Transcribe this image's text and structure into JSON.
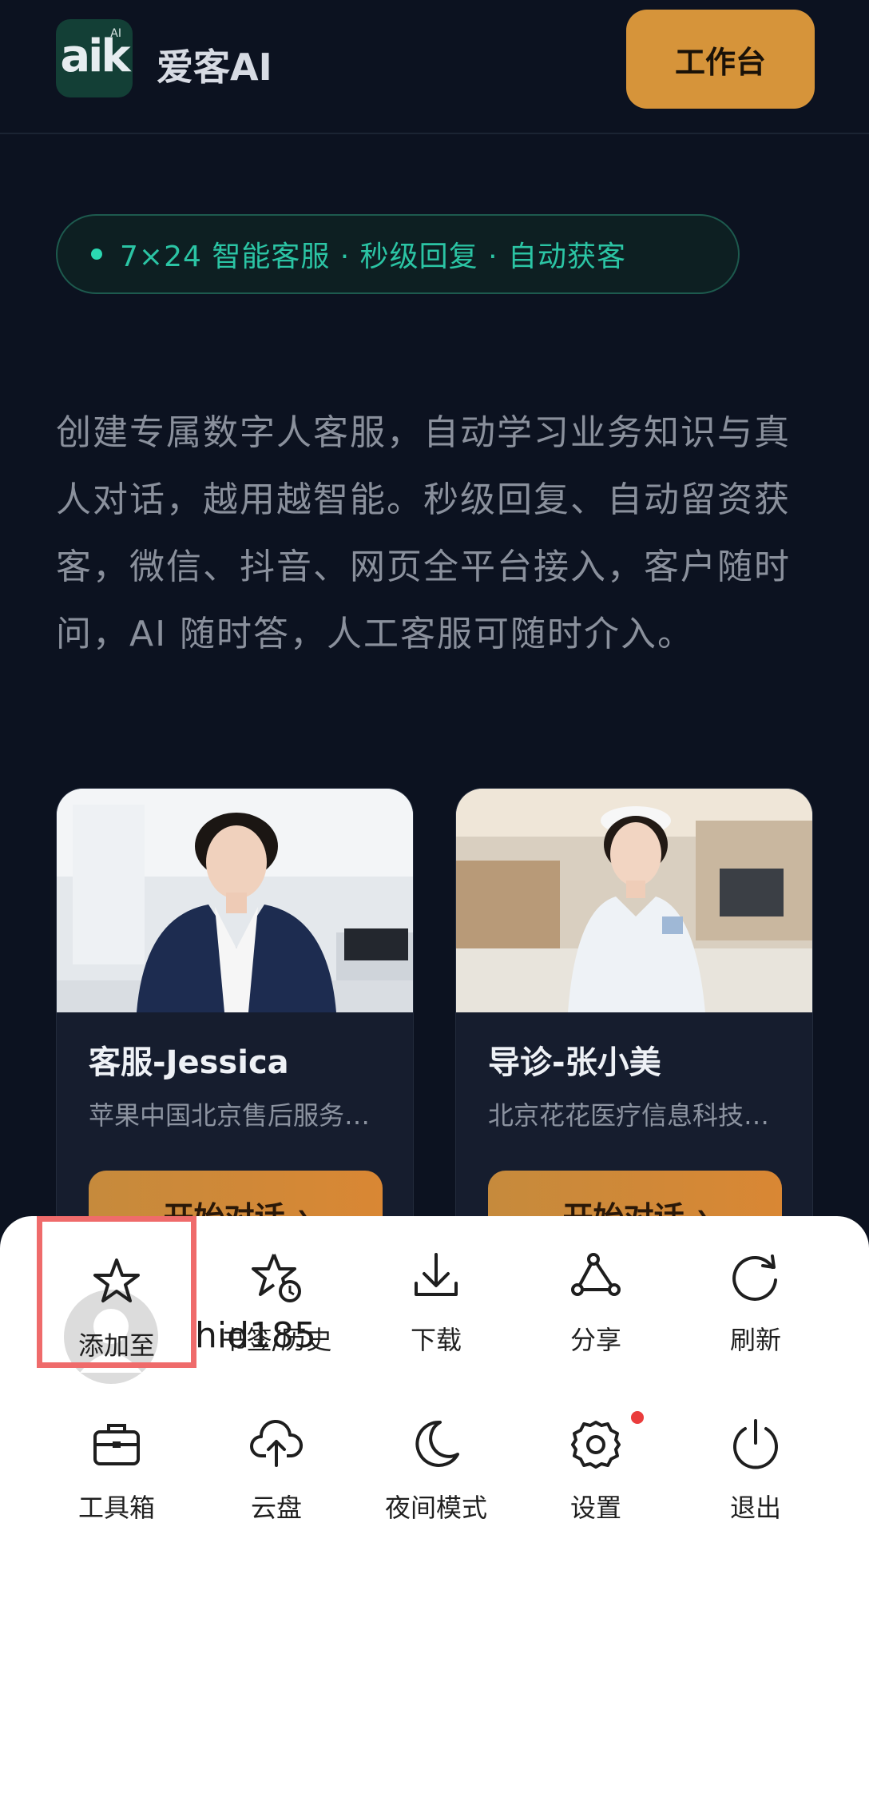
{
  "header": {
    "logo_text": "aik",
    "logo_superscript": "AI",
    "brand_name": "爱客AI",
    "workbench_label": "工作台"
  },
  "badge": {
    "text": "7×24 智能客服 · 秒级回复 · 自动获客"
  },
  "description": "创建专属数字人客服，自动学习业务知识与真人对话，越用越智能。秒级回复、自动留资获客，微信、抖音、网页全平台接入，客户随时问，AI 随时答，人工客服可随时介入。",
  "cards": [
    {
      "name": "客服-Jessica",
      "org": "苹果中国北京售后服务中心",
      "button": "开始对话",
      "arrow": "›"
    },
    {
      "name": "导诊-张小美",
      "org": "北京花花医疗信息科技有限公司",
      "button": "开始对话",
      "arrow": "›"
    }
  ],
  "sheet": {
    "username": "hid185",
    "row1": [
      {
        "label": "添加至",
        "icon": "star-icon"
      },
      {
        "label": "书签/历史",
        "icon": "bookmark-history-icon"
      },
      {
        "label": "下载",
        "icon": "download-icon"
      },
      {
        "label": "分享",
        "icon": "share-icon"
      },
      {
        "label": "刷新",
        "icon": "refresh-icon"
      }
    ],
    "row2": [
      {
        "label": "工具箱",
        "icon": "toolbox-icon"
      },
      {
        "label": "云盘",
        "icon": "cloud-upload-icon"
      },
      {
        "label": "夜间模式",
        "icon": "moon-icon"
      },
      {
        "label": "设置",
        "icon": "gear-icon"
      },
      {
        "label": "退出",
        "icon": "power-icon"
      }
    ]
  },
  "colors": {
    "background": "#0c1220",
    "accent_orange": "#d6943a",
    "badge_green": "#2bc4a4",
    "highlight_red": "#ef6b6b",
    "notification_red": "#ea3c3c"
  }
}
